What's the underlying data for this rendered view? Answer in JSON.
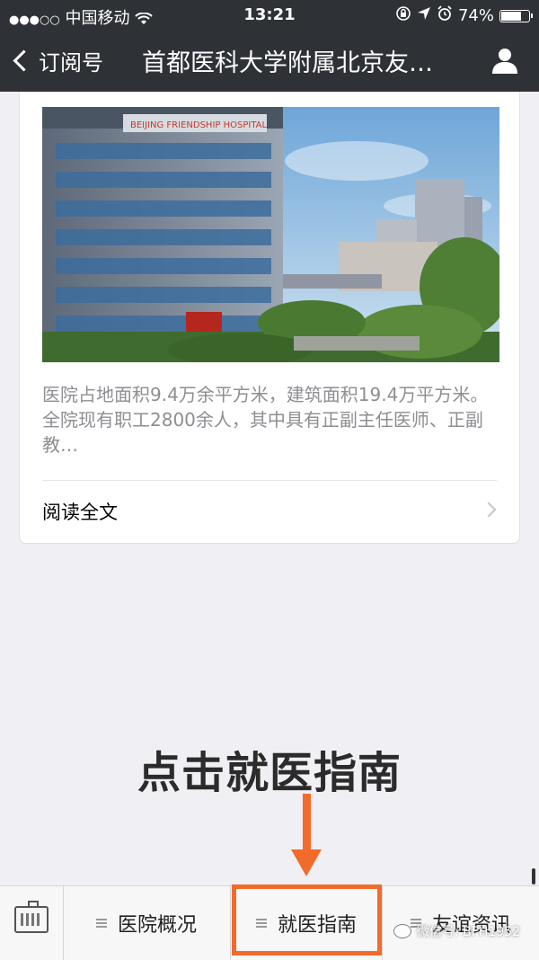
{
  "status_bar": {
    "signal_dots": "●●●○○",
    "carrier": "中国移动",
    "time": "13:21",
    "battery": "74%",
    "battery_level": 0.74
  },
  "nav": {
    "back_label": "订阅号",
    "title": "首都医科大学附属北京友…"
  },
  "article": {
    "summary": "医院占地面积9.4万余平方米，建筑面积19.4万平方米。全院现有职工2800余人，其中具有正副主任医师、正副教…",
    "read_all": "阅读全文",
    "photo_sign": "BEIJING FRIENDSHIP HOSPITAL"
  },
  "annotation": {
    "text": "点击就医指南"
  },
  "bottom_menu": {
    "items": [
      {
        "label": "医院概况"
      },
      {
        "label": "就医指南"
      },
      {
        "label": "友谊资讯"
      }
    ]
  },
  "watermark": {
    "text": "微信号: BFH1952"
  },
  "colors": {
    "topbar": "#2e3136",
    "accent_orange": "#f26b2a",
    "background": "#efeff4"
  }
}
